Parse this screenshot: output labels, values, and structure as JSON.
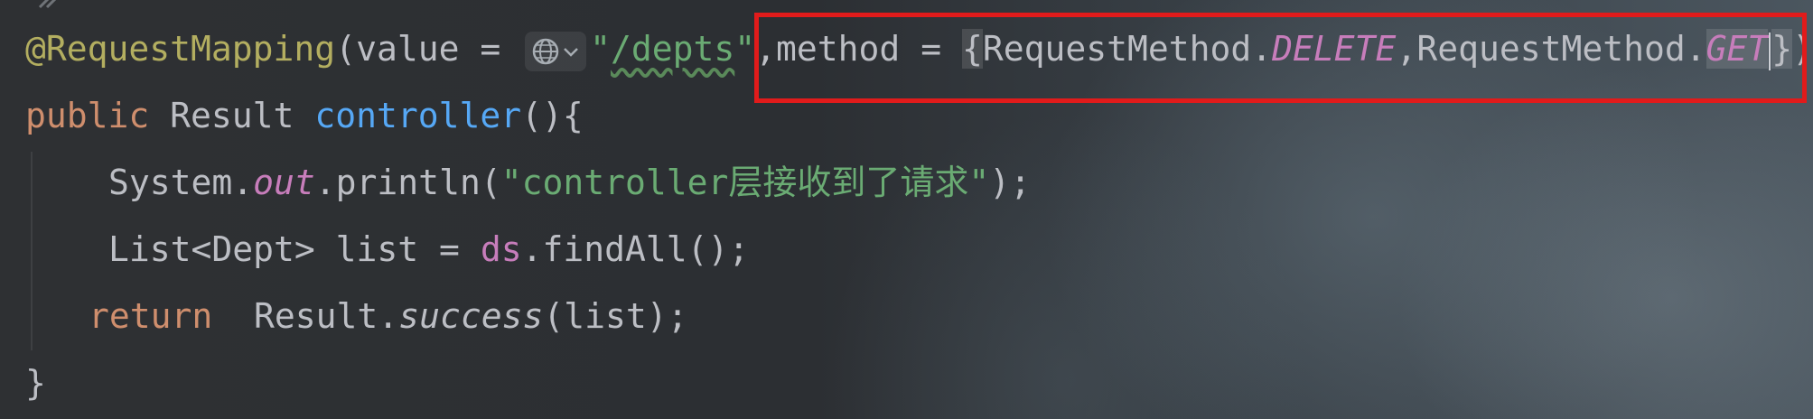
{
  "code": {
    "line1": {
      "annotation": "@RequestMapping",
      "open": "(",
      "value_kw": "value",
      "eq1": " = ",
      "value_str_q1": "\"",
      "value_str_path": "/depts",
      "value_str_q2": "\"",
      "comma1": ",",
      "method_kw": "method",
      "eq2": " = ",
      "brace_open": "{",
      "class1": "RequestMethod.",
      "delete": "DELETE",
      "comma2": ",",
      "class2": "RequestMethod.",
      "get": "GET",
      "brace_close": "}",
      "close": ")"
    },
    "line2": {
      "kw": "public",
      "type": " Result ",
      "method": "controller",
      "rest": "(){"
    },
    "line3": {
      "system": "System.",
      "out": "out",
      "println": ".println(",
      "str": "\"controller层接收到了请求\"",
      "end": ");"
    },
    "line4": {
      "decl": "List<Dept> list = ",
      "ds": "ds",
      "call": ".findAll();"
    },
    "line5": {
      "kw": "return",
      "result": "  Result.",
      "success": "success",
      "args": "(list);"
    },
    "line6": {
      "brace": "}"
    }
  },
  "colors": {
    "annotation": "#b3ae60",
    "keyword": "#cf8e6d",
    "function": "#56a8f5",
    "string": "#6aab73",
    "static_field": "#c77dbb",
    "text": "#bcbec4",
    "highlight_box": "#e11b1b"
  },
  "icons": {
    "inlay_hint": "globe-icon",
    "inlay_chevron": "chevron-down-icon"
  }
}
